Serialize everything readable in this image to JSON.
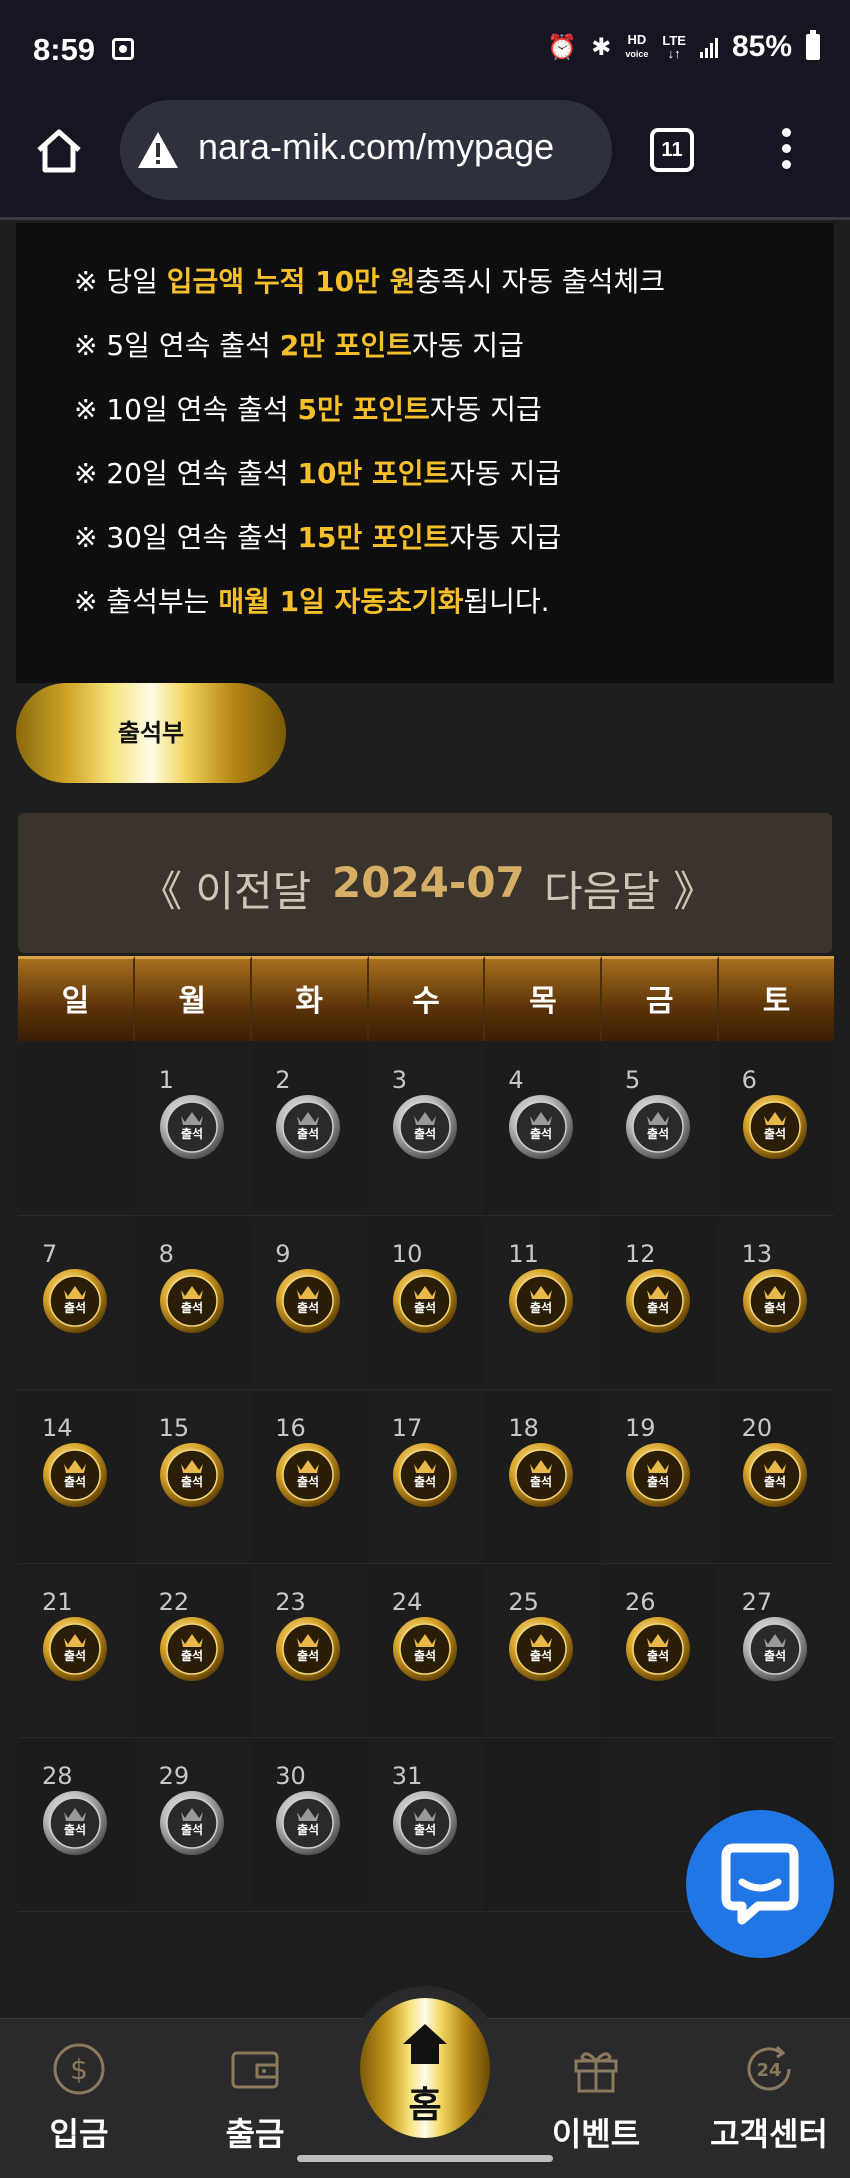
{
  "status_bar": {
    "time": "8:59",
    "hd_label": "HD",
    "voice_label": "voice",
    "lte_label": "LTE",
    "battery": "85%"
  },
  "browser": {
    "url": "nara-mik.com/mypage",
    "tab_count": "11"
  },
  "info": {
    "lines": [
      {
        "pre": "※ 당일 ",
        "hl": "입금액 누적 10만 원",
        "post": "충족시 자동 출석체크"
      },
      {
        "pre": "※ 5일 연속 출석 ",
        "hl": "2만 포인트",
        "post": "자동 지급"
      },
      {
        "pre": "※ 10일 연속 출석 ",
        "hl": "5만 포인트",
        "post": "자동 지급"
      },
      {
        "pre": "※ 20일 연속 출석 ",
        "hl": "10만 포인트",
        "post": "자동 지급"
      },
      {
        "pre": "※ 30일 연속 출석 ",
        "hl": "15만 포인트",
        "post": "자동 지급"
      },
      {
        "pre": "※ 출석부는 ",
        "hl": "매월 1일 자동초기화",
        "post": "됩니다."
      }
    ]
  },
  "attendance_button": "출석부",
  "calendar": {
    "prev_label": "《 이전달",
    "month": "2024-07",
    "next_label": "다음달 》",
    "weekdays": [
      "일",
      "월",
      "화",
      "수",
      "목",
      "금",
      "토"
    ],
    "first_weekday_index": 1,
    "stamp_label": "출석",
    "days": [
      {
        "day": "1",
        "status": "silver"
      },
      {
        "day": "2",
        "status": "silver"
      },
      {
        "day": "3",
        "status": "silver"
      },
      {
        "day": "4",
        "status": "silver"
      },
      {
        "day": "5",
        "status": "silver"
      },
      {
        "day": "6",
        "status": "gold"
      },
      {
        "day": "7",
        "status": "gold"
      },
      {
        "day": "8",
        "status": "gold"
      },
      {
        "day": "9",
        "status": "gold"
      },
      {
        "day": "10",
        "status": "gold"
      },
      {
        "day": "11",
        "status": "gold"
      },
      {
        "day": "12",
        "status": "gold"
      },
      {
        "day": "13",
        "status": "gold"
      },
      {
        "day": "14",
        "status": "gold"
      },
      {
        "day": "15",
        "status": "gold"
      },
      {
        "day": "16",
        "status": "gold"
      },
      {
        "day": "17",
        "status": "gold"
      },
      {
        "day": "18",
        "status": "gold"
      },
      {
        "day": "19",
        "status": "gold"
      },
      {
        "day": "20",
        "status": "gold"
      },
      {
        "day": "21",
        "status": "gold"
      },
      {
        "day": "22",
        "status": "gold"
      },
      {
        "day": "23",
        "status": "gold"
      },
      {
        "day": "24",
        "status": "gold"
      },
      {
        "day": "25",
        "status": "gold"
      },
      {
        "day": "26",
        "status": "gold"
      },
      {
        "day": "27",
        "status": "silver"
      },
      {
        "day": "28",
        "status": "silver"
      },
      {
        "day": "29",
        "status": "silver"
      },
      {
        "day": "30",
        "status": "silver"
      },
      {
        "day": "31",
        "status": "silver"
      }
    ]
  },
  "bottom_nav": {
    "deposit": "입금",
    "withdraw": "출금",
    "home": "홈",
    "event": "이벤트",
    "support": "고객센터"
  },
  "colors": {
    "highlight": "#f5bf2a",
    "gold": "#d9a52c",
    "silver": "#8a8a8a",
    "chat": "#2176e6"
  }
}
